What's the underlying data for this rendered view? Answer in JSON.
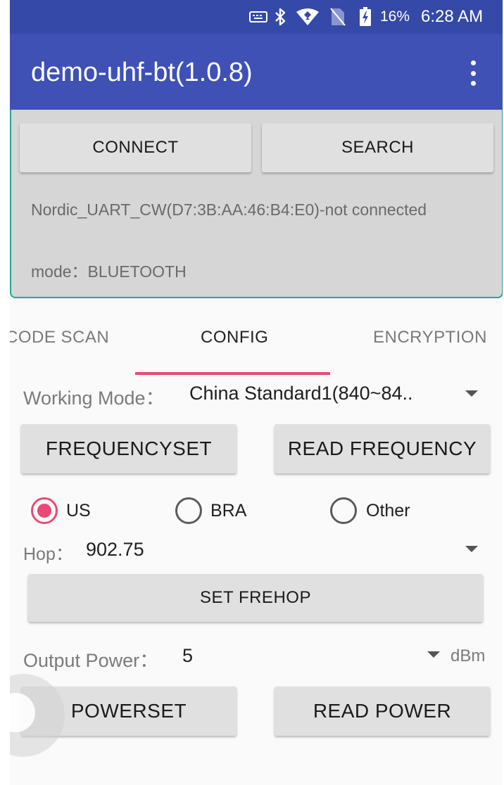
{
  "status_bar": {
    "icons": [
      "keyboard-icon",
      "bluetooth-icon",
      "wifi-icon",
      "no-sim-icon",
      "battery-charging-icon"
    ],
    "battery": "16%",
    "time": "6:28 AM"
  },
  "app_bar": {
    "title": "demo-uhf-bt(1.0.8)",
    "overflow_icon": "more-vert-icon"
  },
  "connection": {
    "connect_label": "CONNECT",
    "search_label": "SEARCH",
    "device_status": "Nordic_UART_CW(D7:3B:AA:46:B4:E0)-not connected",
    "mode_text": "mode：BLUETOOTH"
  },
  "tabs": [
    {
      "label": "CODE SCAN",
      "active": false
    },
    {
      "label": "CONFIG",
      "active": true
    },
    {
      "label": "ENCRYPTION",
      "active": false
    }
  ],
  "config": {
    "working_mode_label": "Working Mode：",
    "working_mode_value": "China Standard1(840~84..",
    "frequencyset_label": "FREQUENCYSET",
    "read_frequency_label": "READ FREQUENCY",
    "regions": [
      {
        "label": "US",
        "checked": true
      },
      {
        "label": "BRA",
        "checked": false
      },
      {
        "label": "Other",
        "checked": false
      }
    ],
    "hop_label": "Hop：",
    "hop_value": "902.75",
    "set_frehop_label": "SET FREHOP",
    "output_power_label": "Output Power：",
    "output_power_value": "5",
    "power_unit": "dBm",
    "powerset_label": "POWERSET",
    "read_power_label": "READ POWER"
  },
  "colors": {
    "status_bar": "#3449a8",
    "app_bar": "#3f51b5",
    "accent": "#e84a74",
    "panel": "#d6d6d6",
    "panel_border": "#21a79a"
  }
}
